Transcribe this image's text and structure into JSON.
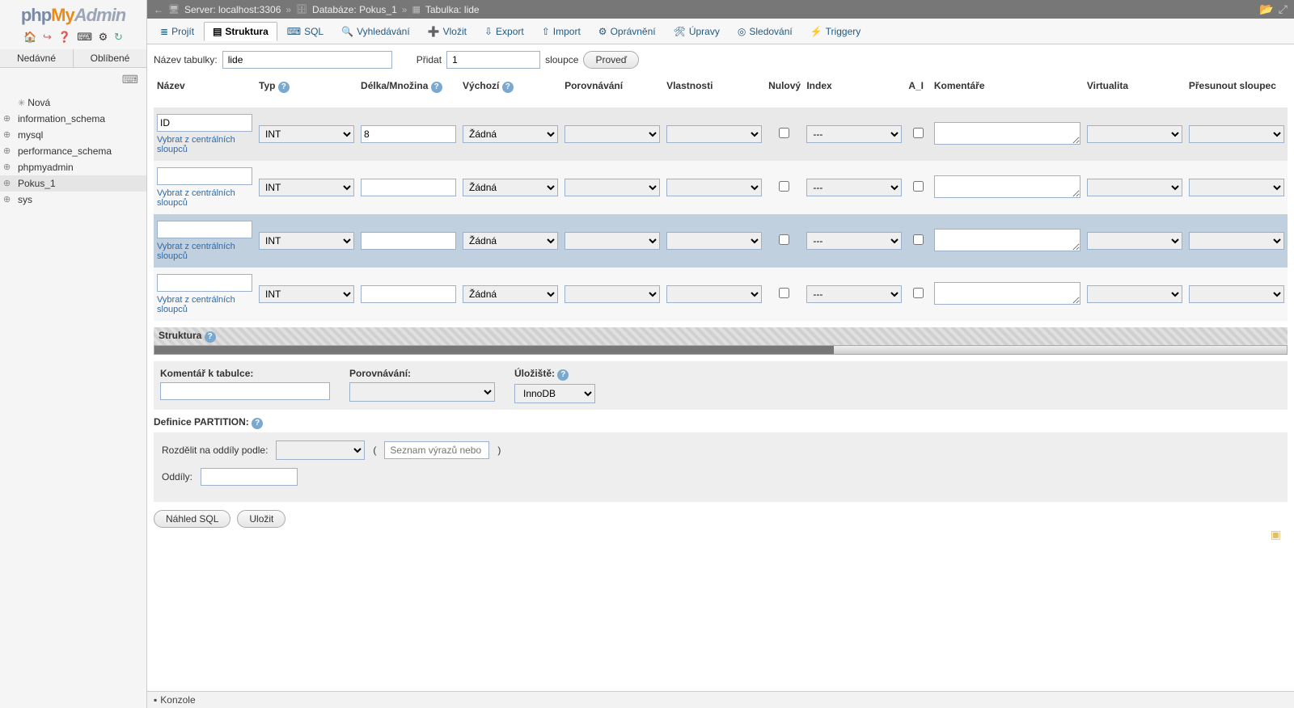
{
  "app_name": {
    "p1": "php",
    "p2": "My",
    "p3": "Admin"
  },
  "sidebar": {
    "navtabs": [
      "Nedávné",
      "Oblíbené"
    ],
    "nodes": [
      {
        "label": "Nová",
        "new": true
      },
      {
        "label": "information_schema"
      },
      {
        "label": "mysql"
      },
      {
        "label": "performance_schema"
      },
      {
        "label": "phpmyadmin"
      },
      {
        "label": "Pokus_1",
        "selected": true
      },
      {
        "label": "sys"
      }
    ]
  },
  "breadcrumb": {
    "server_label": "Server: localhost:3306",
    "db_label": "Databáze: Pokus_1",
    "table_label": "Tabulka: lide"
  },
  "tabs": [
    {
      "label": "Projít",
      "icon": "≣"
    },
    {
      "label": "Struktura",
      "icon": "▤",
      "active": true
    },
    {
      "label": "SQL",
      "icon": "⌨"
    },
    {
      "label": "Vyhledávání",
      "icon": "🔍"
    },
    {
      "label": "Vložit",
      "icon": "➕"
    },
    {
      "label": "Export",
      "icon": "⇩"
    },
    {
      "label": "Import",
      "icon": "⇧"
    },
    {
      "label": "Oprávnění",
      "icon": "⚙"
    },
    {
      "label": "Úpravy",
      "icon": "🛠"
    },
    {
      "label": "Sledování",
      "icon": "◎"
    },
    {
      "label": "Triggery",
      "icon": "⚡"
    }
  ],
  "toprow": {
    "name_label": "Název tabulky:",
    "name_value": "lide",
    "add_label": "Přidat",
    "add_value": "1",
    "cols_label": "sloupce",
    "go_btn": "Proveď"
  },
  "headers": {
    "name": "Název",
    "type": "Typ",
    "len": "Délka/Množina",
    "def": "Výchozí",
    "coll": "Porovnávání",
    "attr": "Vlastnosti",
    "null": "Nulový",
    "idx": "Index",
    "ai": "A_I",
    "cmt": "Komentáře",
    "virt": "Virtualita",
    "move": "Přesunout sloupec"
  },
  "centrals_link": "Vybrat z centrálních sloupců",
  "type_default": "INT",
  "def_default": "Žádná",
  "idx_default": "---",
  "rows": [
    {
      "name": "ID",
      "len": "8",
      "hover": false,
      "odd": true
    },
    {
      "name": "",
      "len": "",
      "hover": false,
      "odd": false
    },
    {
      "name": "",
      "len": "",
      "hover": true,
      "odd": true
    },
    {
      "name": "",
      "len": "",
      "hover": false,
      "odd": false
    }
  ],
  "band": {
    "label": "Struktura"
  },
  "tableopts": {
    "comment_label": "Komentář k tabulce:",
    "collation_label": "Porovnávání:",
    "storage_label": "Úložiště:",
    "storage_value": "InnoDB"
  },
  "partition": {
    "label": "Definice PARTITION:",
    "by_label": "Rozdělit na oddíly podle:",
    "expr_placeholder": "Seznam výrazů nebo slou",
    "count_label": "Oddíly:"
  },
  "actions": {
    "preview": "Náhled SQL",
    "save": "Uložit"
  },
  "console": {
    "label": "Konzole"
  }
}
